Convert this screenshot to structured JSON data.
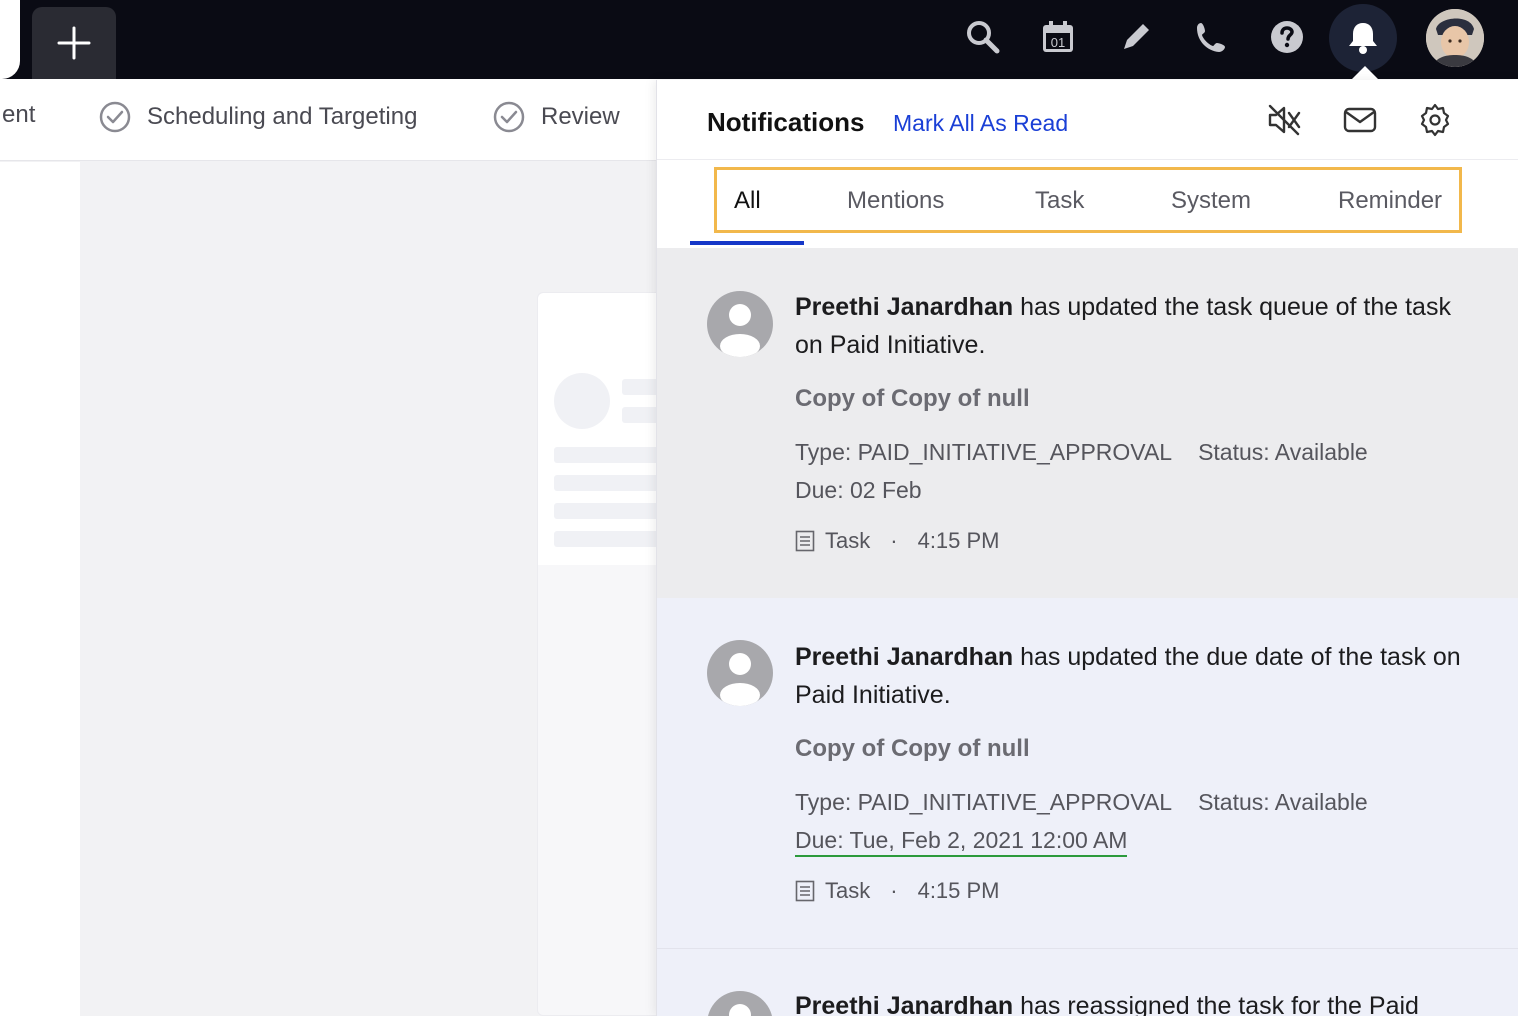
{
  "topbar": {
    "icons": [
      "plus-icon",
      "search-icon",
      "calendar-icon",
      "pencil-icon",
      "phone-icon",
      "help-icon",
      "bell-icon"
    ],
    "calendar_day": "01"
  },
  "stepper": {
    "items": [
      {
        "label": "ent"
      },
      {
        "label": "Scheduling and Targeting"
      },
      {
        "label": "Review"
      }
    ]
  },
  "notifications": {
    "title": "Notifications",
    "mark_all": "Mark All As Read",
    "tabs": [
      {
        "label": "All",
        "active": true
      },
      {
        "label": "Mentions"
      },
      {
        "label": "Task"
      },
      {
        "label": "System"
      },
      {
        "label": "Reminder"
      }
    ],
    "items": [
      {
        "actor": "Preethi Janardhan",
        "message": " has updated the task queue of the task on Paid Initiative.",
        "subject": "Copy of Copy of null",
        "type": "Type: PAID_INITIATIVE_APPROVAL",
        "status": "Status: Available",
        "due": "Due: 02 Feb",
        "category": "Task",
        "time": "4:15 PM"
      },
      {
        "actor": "Preethi Janardhan",
        "message": " has updated the due date of the task on Paid Initiative.",
        "subject": "Copy of Copy of null",
        "type": "Type: PAID_INITIATIVE_APPROVAL",
        "status": "Status: Available",
        "due": "Due: Tue, Feb 2, 2021 12:00 AM",
        "category": "Task",
        "time": "4:15 PM"
      },
      {
        "actor": "Preethi Janardhan",
        "message": " has reassigned the task for the Paid"
      }
    ],
    "separator": "·"
  },
  "colors": {
    "topbar": "#0a0b14",
    "accent": "#1a3fd6",
    "tabs_highlight": "#f2b84b",
    "due_underline": "#2c9a3c"
  }
}
